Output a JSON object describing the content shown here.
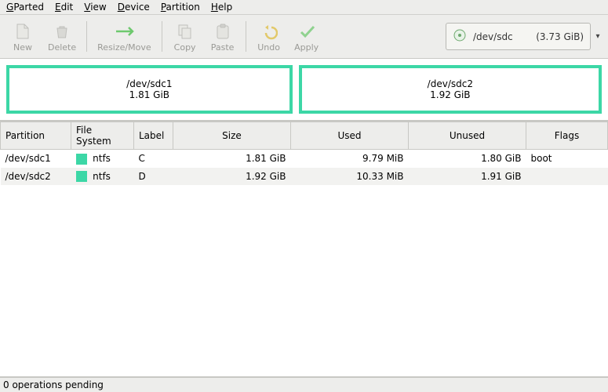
{
  "menu": {
    "gparted": "GParted",
    "edit": "Edit",
    "view": "View",
    "device": "Device",
    "partition": "Partition",
    "help": "Help"
  },
  "toolbar": {
    "new": "New",
    "delete": "Delete",
    "resize": "Resize/Move",
    "copy": "Copy",
    "paste": "Paste",
    "undo": "Undo",
    "apply": "Apply"
  },
  "device": {
    "name": "/dev/sdc",
    "size": "(3.73 GiB)"
  },
  "viz": {
    "p1name": "/dev/sdc1",
    "p1size": "1.81 GiB",
    "p2name": "/dev/sdc2",
    "p2size": "1.92 GiB"
  },
  "columns": {
    "partition": "Partition",
    "filesystem": "File System",
    "label": "Label",
    "size": "Size",
    "used": "Used",
    "unused": "Unused",
    "flags": "Flags"
  },
  "rows": [
    {
      "partition": "/dev/sdc1",
      "fs": "ntfs",
      "label": "C",
      "size": "1.81 GiB",
      "used": "9.79 MiB",
      "unused": "1.80 GiB",
      "flags": "boot"
    },
    {
      "partition": "/dev/sdc2",
      "fs": "ntfs",
      "label": "D",
      "size": "1.92 GiB",
      "used": "10.33 MiB",
      "unused": "1.91 GiB",
      "flags": ""
    }
  ],
  "status": "0 operations pending",
  "fs_color": "#3cd7a6"
}
